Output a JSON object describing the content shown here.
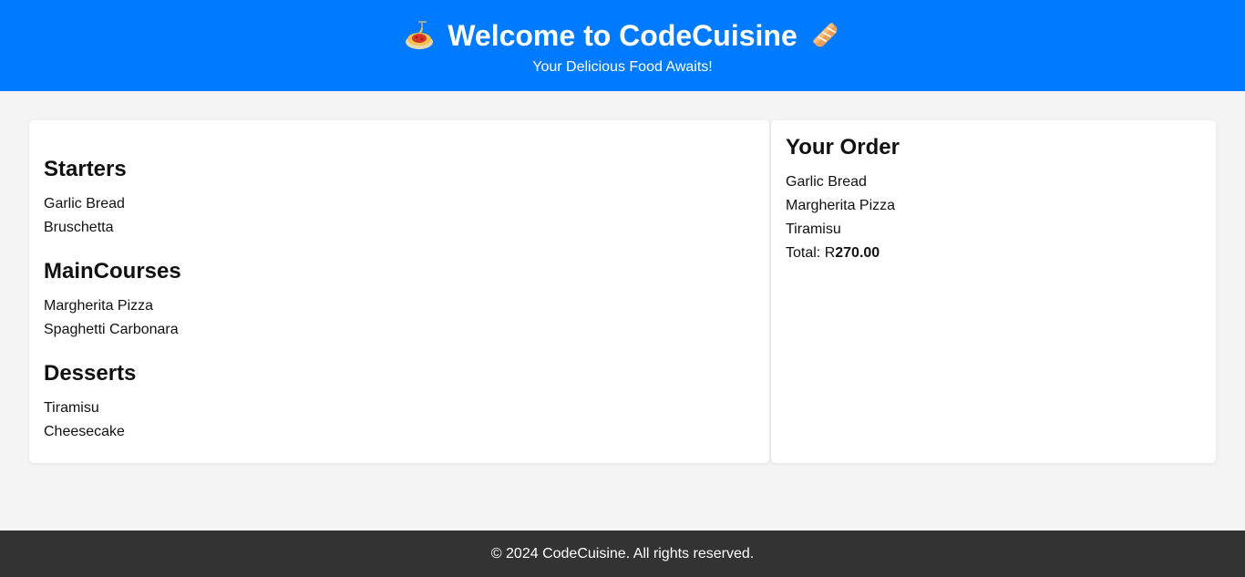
{
  "header": {
    "title": "Welcome to CodeCuisine",
    "subtitle": "Your Delicious Food Awaits!",
    "left_icon": "spaghetti-icon",
    "right_icon": "baguette-icon",
    "background_color": "#007bff"
  },
  "menu": {
    "sections": [
      {
        "title": "Starters",
        "items": [
          "Garlic Bread",
          "Bruschetta"
        ]
      },
      {
        "title": "MainCourses",
        "items": [
          "Margherita Pizza",
          "Spaghetti Carbonara"
        ]
      },
      {
        "title": "Desserts",
        "items": [
          "Tiramisu",
          "Cheesecake"
        ]
      }
    ]
  },
  "order": {
    "title": "Your Order",
    "items": [
      "Garlic Bread",
      "Margherita Pizza",
      "Tiramisu"
    ],
    "total_label": "Total: R",
    "total_amount": "270.00"
  },
  "footer": {
    "text": "© 2024 CodeCuisine. All rights reserved.",
    "background_color": "#333333"
  }
}
